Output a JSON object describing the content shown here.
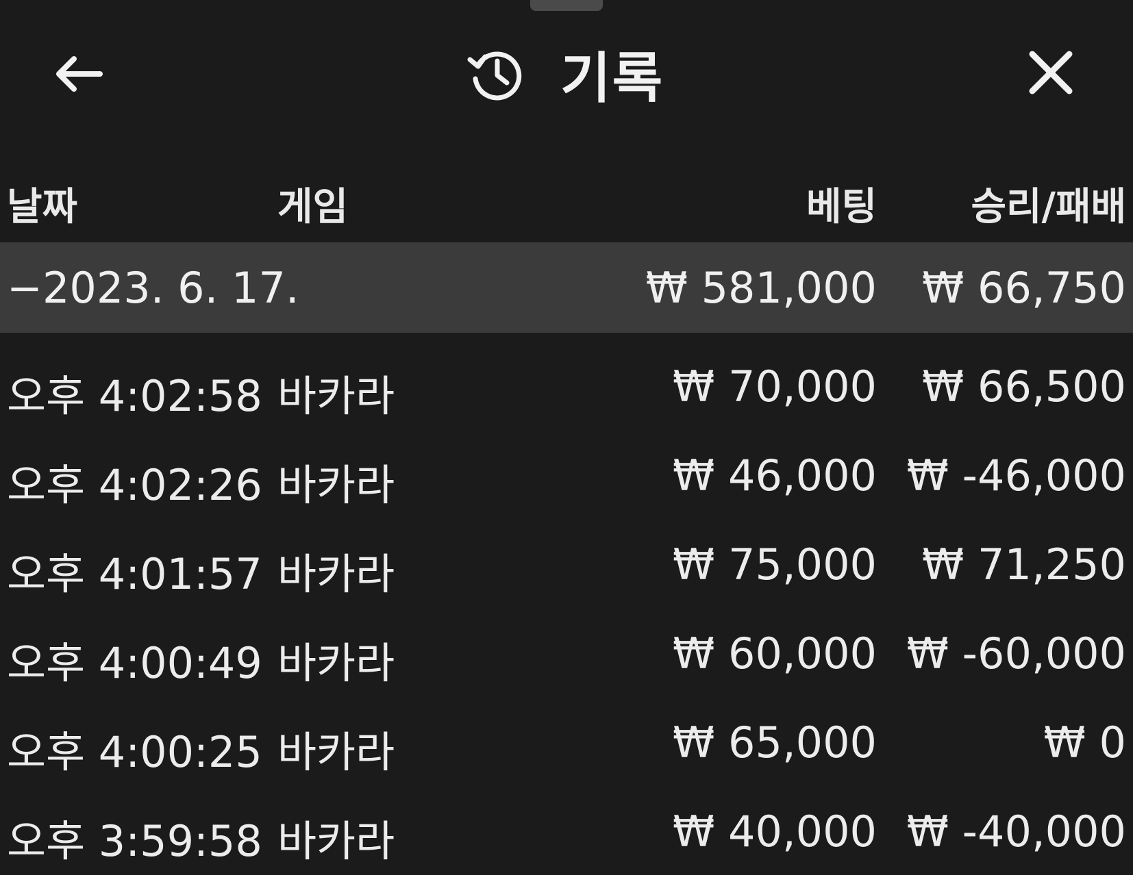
{
  "header": {
    "title": "기록",
    "back_icon": "arrow-left-icon",
    "history_icon": "history-clock-icon",
    "close_icon": "close-icon"
  },
  "columns": {
    "date": "날짜",
    "game": "게임",
    "bet": "베팅",
    "result": "승리/패배"
  },
  "summary": {
    "date": "−2023. 6. 17.",
    "bet": "₩ 581,000",
    "result": "₩ 66,750"
  },
  "rows": [
    {
      "time": "오후 4:02:58",
      "game": "바카라",
      "bet": "₩ 70,000",
      "result": "₩ 66,500"
    },
    {
      "time": "오후 4:02:26",
      "game": "바카라",
      "bet": "₩ 46,000",
      "result": "₩ -46,000"
    },
    {
      "time": "오후 4:01:57",
      "game": "바카라",
      "bet": "₩ 75,000",
      "result": "₩ 71,250"
    },
    {
      "time": "오후 4:00:49",
      "game": "바카라",
      "bet": "₩ 60,000",
      "result": "₩ -60,000"
    },
    {
      "time": "오후 4:00:25",
      "game": "바카라",
      "bet": "₩ 65,000",
      "result": "₩ 0"
    },
    {
      "time": "오후 3:59:58",
      "game": "바카라",
      "bet": "₩ 40,000",
      "result": "₩ -40,000"
    }
  ],
  "colors": {
    "background": "#1b1b1c",
    "summary_row": "#3b3b3c",
    "text": "#ececec"
  }
}
